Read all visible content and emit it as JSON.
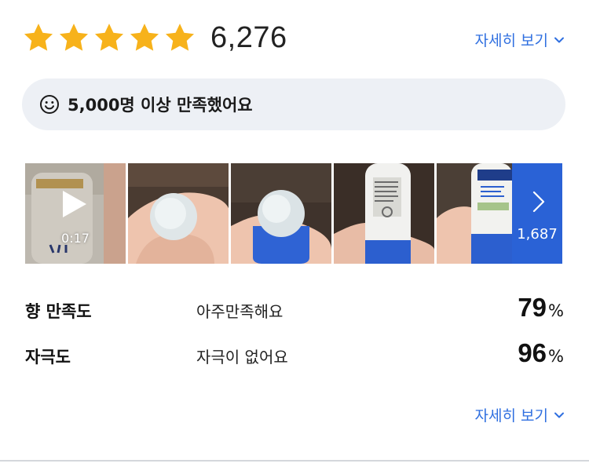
{
  "rating": {
    "stars_filled": 5,
    "stars_total": 5,
    "count": "6,276",
    "star_color": "#f7b21b"
  },
  "detail_link_top": {
    "label": "자세히 보기",
    "icon": "chevron-down-icon"
  },
  "satisfaction": {
    "icon": "smile-icon",
    "text": "5,000명 이상 만족했어요"
  },
  "media": {
    "video_duration": "0:17",
    "more_count": "1,687",
    "more_icon": "chevron-right-icon",
    "accent": "#2a62d6"
  },
  "stats": [
    {
      "label": "향 만족도",
      "value": "아주만족해요",
      "percent": "79",
      "unit": "%"
    },
    {
      "label": "자극도",
      "value": "자극이 없어요",
      "percent": "96",
      "unit": "%"
    }
  ],
  "detail_link_bottom": {
    "label": "자세히 보기",
    "icon": "chevron-down-icon"
  },
  "link_color": "#2f6fe0"
}
